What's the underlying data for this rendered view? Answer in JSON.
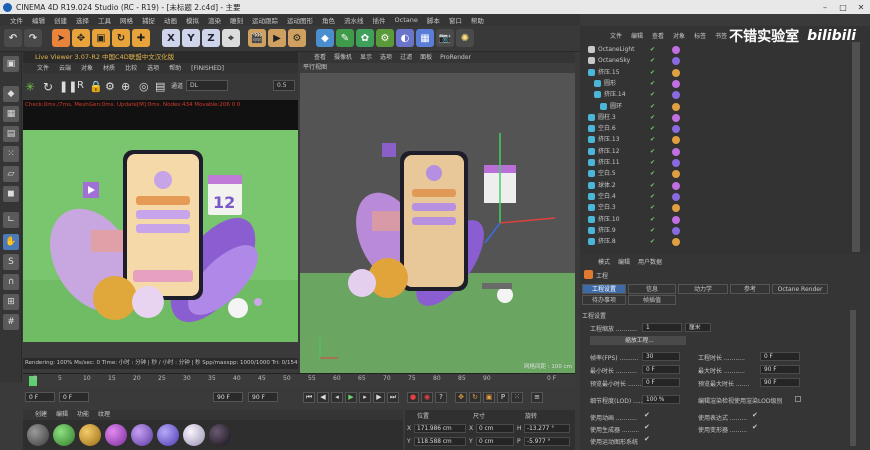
{
  "window": {
    "title": "CINEMA 4D R19.024 Studio (RC - R19) - [未标题 2.c4d] - 主要"
  },
  "menu": [
    "文件",
    "编辑",
    "创建",
    "选择",
    "工具",
    "网格",
    "捕捉",
    "动画",
    "模拟",
    "渲染",
    "雕刻",
    "运动跟踪",
    "运动图形",
    "角色",
    "流水线",
    "插件",
    "Octane",
    "脚本",
    "窗口",
    "帮助"
  ],
  "toolbar": {
    "x": "X",
    "y": "Y",
    "z": "Z"
  },
  "live_viewer": {
    "title": "Live Viewer 3.07-R2 中国C4D联盟中文汉化版",
    "menu": [
      "文件",
      "云端",
      "对象",
      "材质",
      "比较",
      "选项",
      "帮助",
      "[FINISHED]"
    ],
    "mode_label": "通道",
    "mode_value": "DL",
    "value": "0.5",
    "status": "Check:0ms./7ms. MeshGen:0ms. Update[M]:0ms. Nodes:434 Movable:206  0 0",
    "footer": "Rendering: 100%   Ms/sec: 0   Time: 小时 : 分钟 | 秒 / 小时 : 分钟 | 秒   Spp/maxspp: 1000/1000   Tri: 0/154k"
  },
  "viewport": {
    "menu": [
      "查看",
      "摄像机",
      "显示",
      "选项",
      "过滤",
      "面板",
      "ProRender"
    ],
    "label": "平行视图",
    "footer": "网格间距 : 100 cm",
    "calendar_number": "12"
  },
  "timeline": {
    "ticks": [
      "0",
      "5",
      "10",
      "15",
      "20",
      "25",
      "30",
      "35",
      "40",
      "45",
      "50",
      "55",
      "60",
      "65",
      "70",
      "75",
      "80",
      "85",
      "90"
    ],
    "end_label": "0 F"
  },
  "transport": {
    "start": "0 F",
    "current": "0 F",
    "end": "90 F",
    "end2": "90 F"
  },
  "materials": {
    "menu": [
      "创建",
      "编辑",
      "功能",
      "纹理"
    ],
    "colors": [
      "#6a6a6a",
      "#58b454",
      "#d8a73a",
      "#b85ad0",
      "#a975e0",
      "#9a80e8",
      "#d8d0e8",
      "#2a2a2a"
    ]
  },
  "coords": {
    "headers": [
      "位置",
      "尺寸",
      "旋转"
    ],
    "x": "171.986 cm",
    "y": "118.588 cm",
    "sx": "0 cm",
    "sy": "0 cm",
    "h": "-13.277 °",
    "p": "-5.977 °"
  },
  "object_manager": {
    "menu": [
      "文件",
      "编辑",
      "查看",
      "对象",
      "标签",
      "书签"
    ],
    "objects": [
      "OctaneLight",
      "OctaneSky",
      "挤压.15",
      "圆形",
      "挤压.14",
      "圆环",
      "圆柱.3",
      "空白.6",
      "挤压.13",
      "挤压.12",
      "挤压.11",
      "空白.5",
      "球体.2",
      "空白.4",
      "空白.3",
      "挤压.10",
      "挤压.9",
      "挤压.8"
    ],
    "watermark": "不错实验室",
    "watermark2": "bilibili"
  },
  "attributes": {
    "menu": [
      "模式",
      "编辑",
      "用户数据"
    ],
    "title": "工程",
    "tabs": [
      "工程设置",
      "信息",
      "动力学",
      "参考",
      "Octane Render",
      "待办事项",
      "帧插值"
    ],
    "section": "工程设置",
    "scale_label": "工程缩放 ...........",
    "scale_value": "1",
    "scale_unit": "厘米",
    "scale_button": "缩放工程...",
    "fps_label": "帧率(FPS) ..........",
    "fps_value": "30",
    "min_label": "最小时长 ...........",
    "min_value": "0 F",
    "pmin_label": "预览最小时长 .......",
    "pmin_value": "0 F",
    "lod_label": "细节程度(LOD) ......",
    "lod_value": "100 %",
    "time_label": "工程时长 ...........",
    "time_value": "0 F",
    "max_label": "最大时长 ...........",
    "max_value": "90 F",
    "pmax_label": "预览最大时长 .......",
    "pmax_value": "90 F",
    "lodrender_label": "编辑渲染检视使用渲染LOD级别",
    "anim_label": "使用动画 ...........",
    "expr_label": "使用表达式 .........",
    "gen_label": "使用生成器 .........",
    "deform_label": "使用变形器 .........",
    "mograph_label": "使用运动图形系统"
  }
}
